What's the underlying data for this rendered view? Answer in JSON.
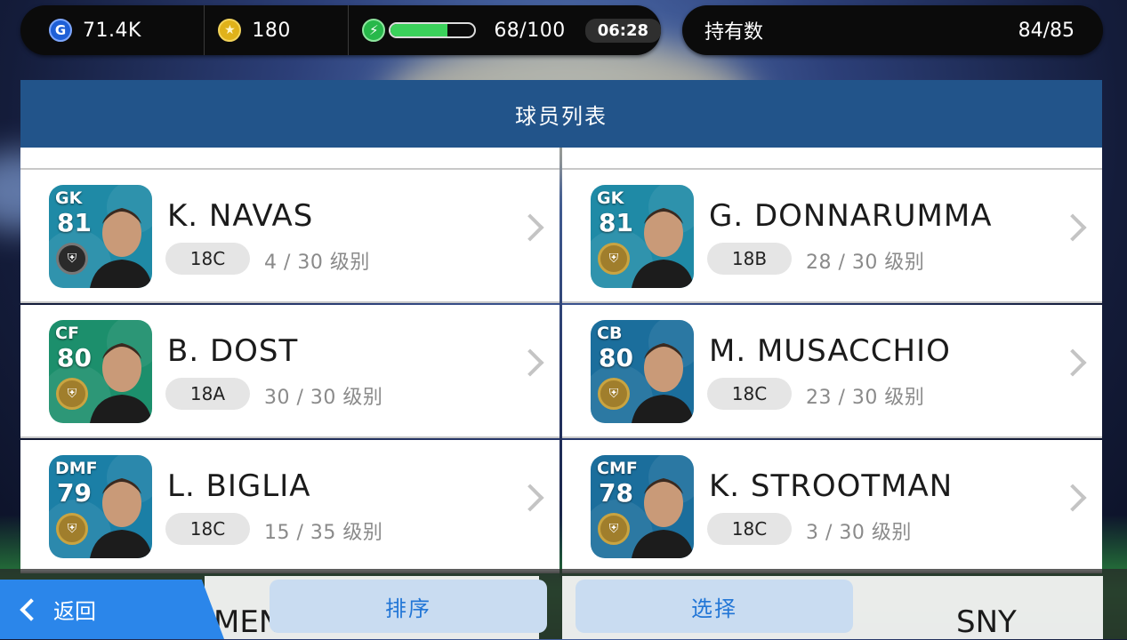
{
  "status": {
    "gp": "71.4K",
    "coins": "180",
    "energy_text": "68/100",
    "energy_fraction": 0.68,
    "timer": "06:28",
    "owned_label": "持有数",
    "owned_value": "84/85"
  },
  "panel": {
    "title": "球员列表"
  },
  "players": [
    {
      "pos": "GK",
      "rating": "81",
      "name": "K. NAVAS",
      "version": "18C",
      "level": "4 / 30 级别",
      "card_color": "#1f8aa6",
      "badge": "black"
    },
    {
      "pos": "GK",
      "rating": "81",
      "name": "G. DONNARUMMA",
      "version": "18B",
      "level": "28 / 30 级别",
      "card_color": "#1f8aa6",
      "badge": "gold"
    },
    {
      "pos": "CF",
      "rating": "80",
      "name": "B. DOST",
      "version": "18A",
      "level": "30 / 30 级别",
      "card_color": "#1c8f6c",
      "badge": "gold"
    },
    {
      "pos": "CB",
      "rating": "80",
      "name": "M. MUSACCHIO",
      "version": "18C",
      "level": "23 / 30 级别",
      "card_color": "#1b6e9c",
      "badge": "gold"
    },
    {
      "pos": "DMF",
      "rating": "79",
      "name": "L. BIGLIA",
      "version": "18C",
      "level": "15 / 35 级别",
      "card_color": "#1b7fa6",
      "badge": "gold"
    },
    {
      "pos": "CMF",
      "rating": "78",
      "name": "K. STROOTMAN",
      "version": "18C",
      "level": "3 / 30 级别",
      "card_color": "#1b6e9c",
      "badge": "gold"
    }
  ],
  "peek": {
    "left_name": "MENE",
    "right_name": "SNY"
  },
  "buttons": {
    "back": "返回",
    "sort": "排序",
    "select": "选择"
  },
  "colors": {
    "header": "#22548a",
    "accent": "#2b86ea",
    "button_bg": "#c9dcf1"
  }
}
